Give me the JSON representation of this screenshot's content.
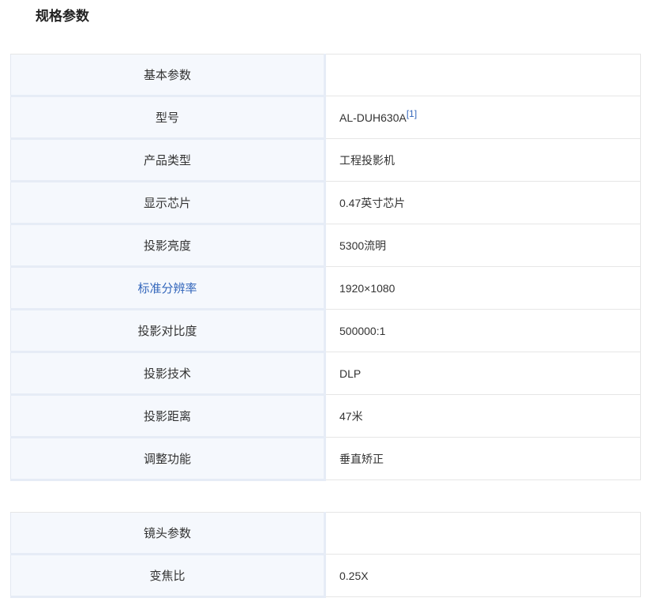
{
  "page": {
    "section_title": "规格参数"
  },
  "basic_table": {
    "rows": [
      {
        "key": "基本参数",
        "value": "",
        "ref": ""
      },
      {
        "key": "型号",
        "value": "AL-DUH630A",
        "ref": "[1]"
      },
      {
        "key": "产品类型",
        "value": "工程投影机",
        "ref": ""
      },
      {
        "key": "显示芯片",
        "value": "0.47英寸芯片",
        "ref": ""
      },
      {
        "key": "投影亮度",
        "value": "5300流明",
        "ref": ""
      },
      {
        "key": "标准分辨率",
        "value": "1920×1080",
        "ref": ""
      },
      {
        "key": "投影对比度",
        "value": "500000:1",
        "ref": ""
      },
      {
        "key": "投影技术",
        "value": "DLP",
        "ref": ""
      },
      {
        "key": "投影距离",
        "value": "47米",
        "ref": ""
      },
      {
        "key": "调整功能",
        "value": "垂直矫正",
        "ref": ""
      }
    ]
  },
  "lens_table": {
    "rows": [
      {
        "key": "镜头参数",
        "value": "",
        "ref": ""
      },
      {
        "key": "变焦比",
        "value": "0.25X",
        "ref": ""
      }
    ]
  },
  "colors": {
    "link": "#3366bb",
    "key_bg": "#f5f8fd",
    "border": "#e6e6e6"
  }
}
